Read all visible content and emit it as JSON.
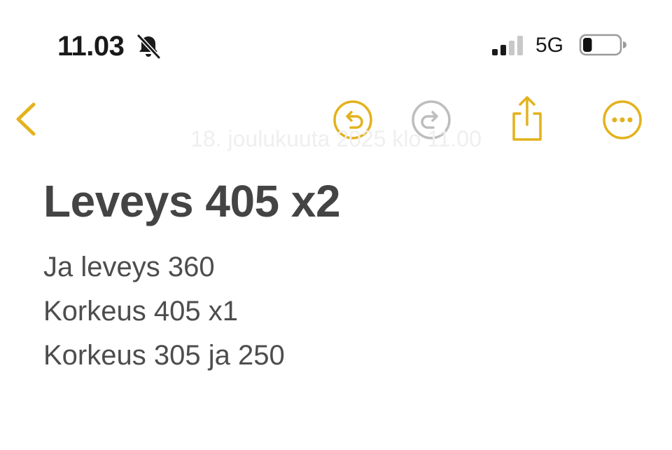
{
  "status_bar": {
    "time": "11.03",
    "network": "5G",
    "bell_icon": "bell-slash-icon",
    "signal_icon": "cellular-signal-icon",
    "battery_icon": "battery-icon",
    "battery_level": 0.25
  },
  "toolbar": {
    "back_icon": "chevron-left-icon",
    "undo_icon": "undo-icon",
    "redo_icon": "redo-icon",
    "share_icon": "share-icon",
    "more_icon": "ellipsis-circle-icon",
    "accent_color": "#E3B21C",
    "disabled_color": "#BDBDBD"
  },
  "note": {
    "date": "18. joulukuuta 2025 klo 11.00",
    "title": "Leveys 405 x2",
    "lines": [
      "Ja leveys 360",
      "Korkeus 405 x1",
      "Korkeus 305 ja 250"
    ]
  }
}
